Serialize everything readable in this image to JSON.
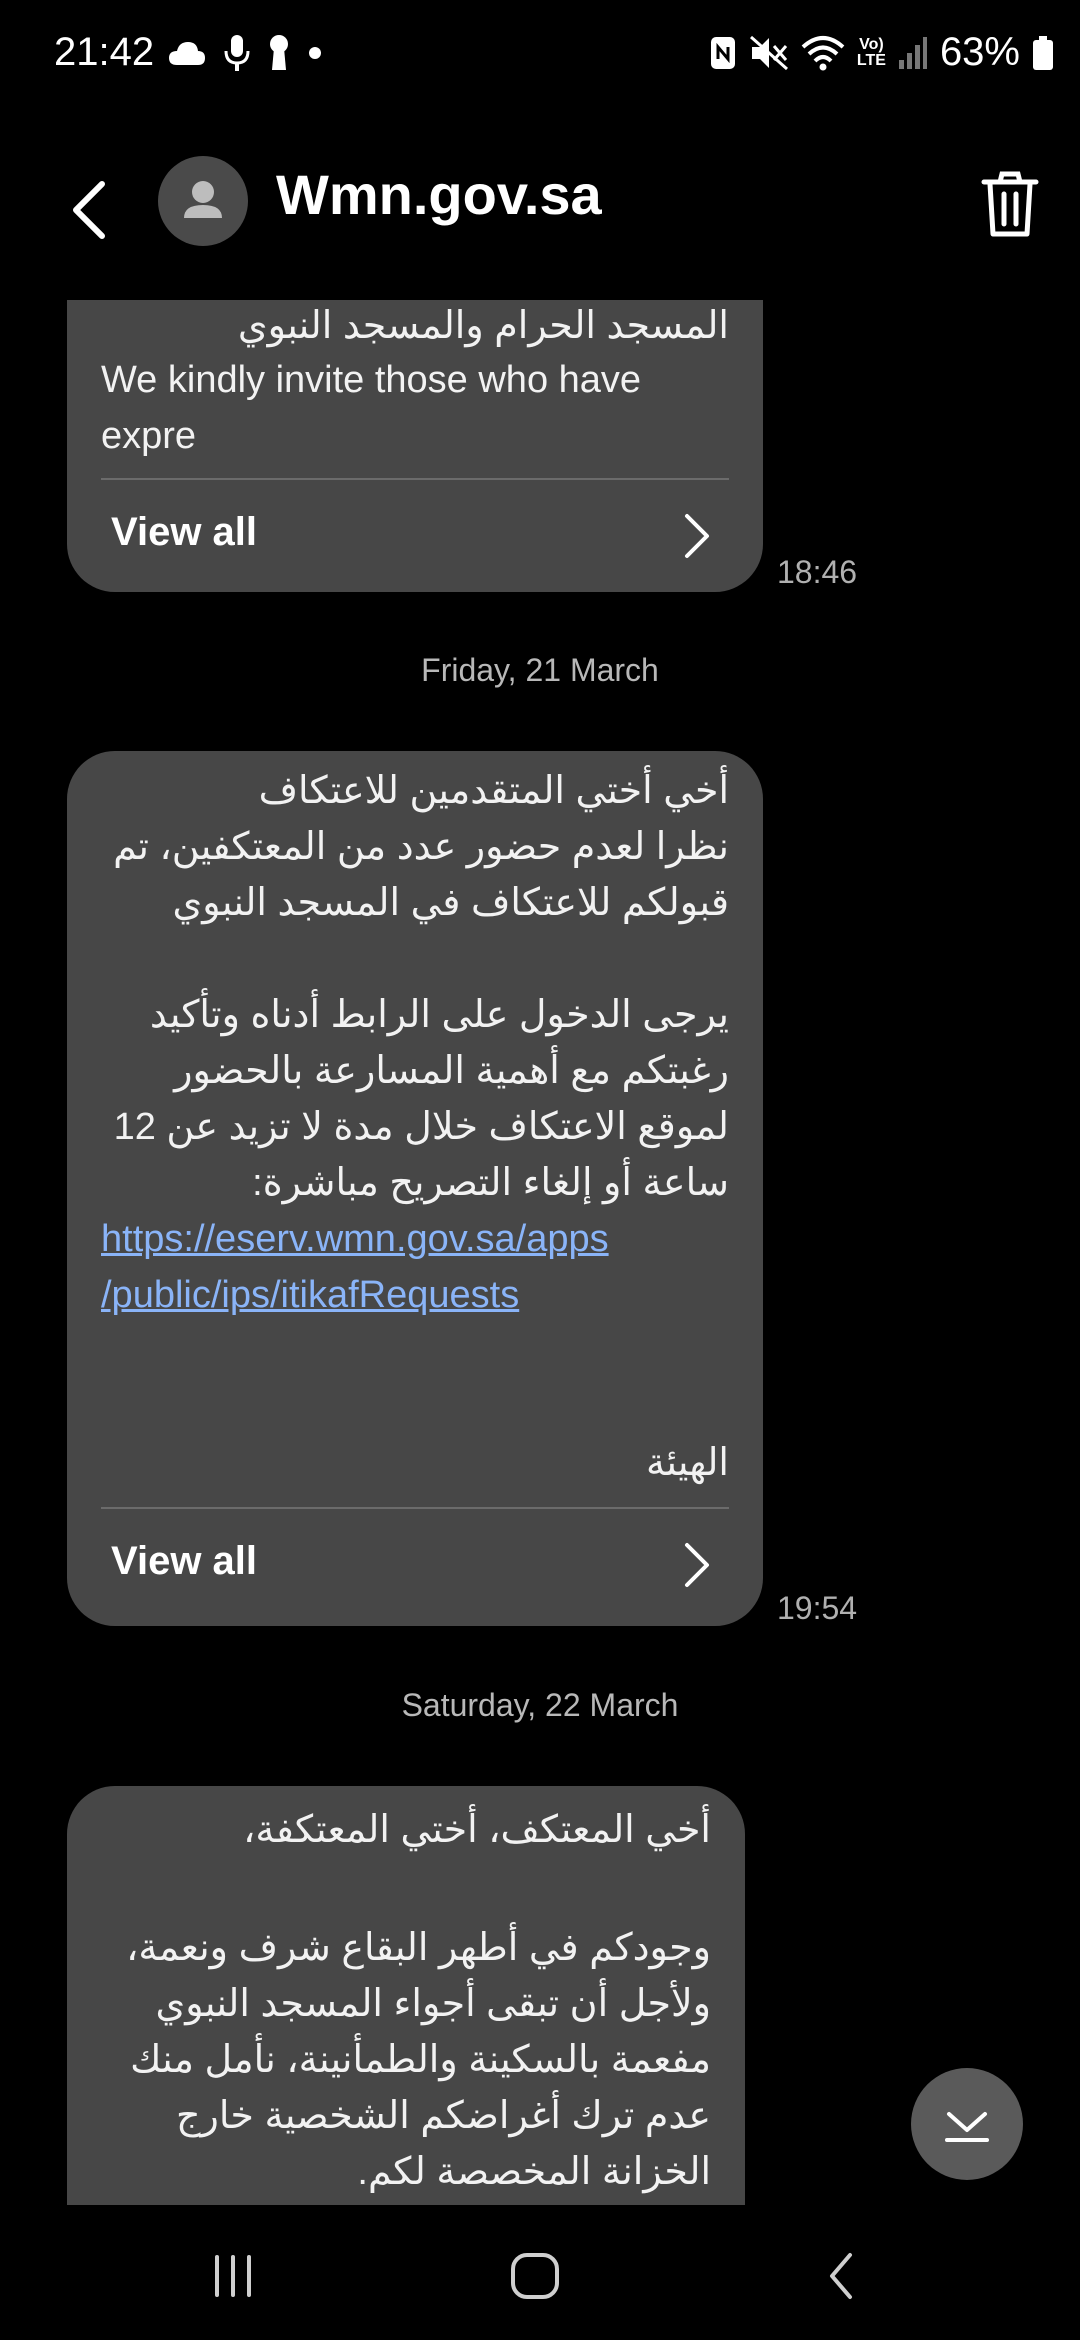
{
  "status_bar": {
    "time": "21:42",
    "battery": "63%",
    "volte_top": "Vo)",
    "volte_bottom": "LTE",
    "icons": [
      "cloud-icon",
      "mic-icon",
      "keyhole-icon",
      "dot-icon",
      "nfc-icon",
      "mute-icon",
      "wifi-icon",
      "volte-icon",
      "signal-icon",
      "battery-icon"
    ]
  },
  "header": {
    "contact_name": "Wmn.gov.sa"
  },
  "messages": [
    {
      "lines": [
        "المسجد الحرام والمسجد النبوي"
      ],
      "english_lines": [
        "We kindly invite those who have",
        "expre"
      ],
      "view_all": "View all",
      "time": "18:46"
    },
    {
      "date_separator": "Friday, 21 March",
      "lines": [
        "أخي أختي المتقدمين للاعتكاف",
        "نظرا لعدم حضور عدد من المعتكفين، تم",
        "قبولكم للاعتكاف في المسجد النبوي",
        "",
        "يرجى الدخول على الرابط أدناه وتأكيد",
        "رغبتكم مع أهمية المسارعة بالحضور",
        "لموقع الاعتكاف خلال مدة لا تزيد عن 12",
        "ساعة أو إلغاء التصريح مباشرة:"
      ],
      "link_lines": [
        "https://eserv.wmn.gov.sa/apps",
        "/public/ips/itikafRequests"
      ],
      "signature": "الهيئة",
      "view_all": "View all",
      "time": "19:54"
    },
    {
      "date_separator": "Saturday, 22 March",
      "lines": [
        "أخي المعتكف، أختي المعتكفة،",
        "",
        "وجودكم في أطهر البقاع شرف ونعمة،",
        "ولأجل أن تبقى أجواء المسجد النبوي",
        "مفعمة بالسكينة والطمأنينة، نأمل منك",
        "عدم ترك أغراضكم الشخصية خارج",
        "الخزانة المخصصة لكم."
      ]
    }
  ],
  "colors": {
    "background": "#000000",
    "bubble": "#474747",
    "link": "#8ab4f8",
    "timestamp": "#b0b0b0"
  }
}
